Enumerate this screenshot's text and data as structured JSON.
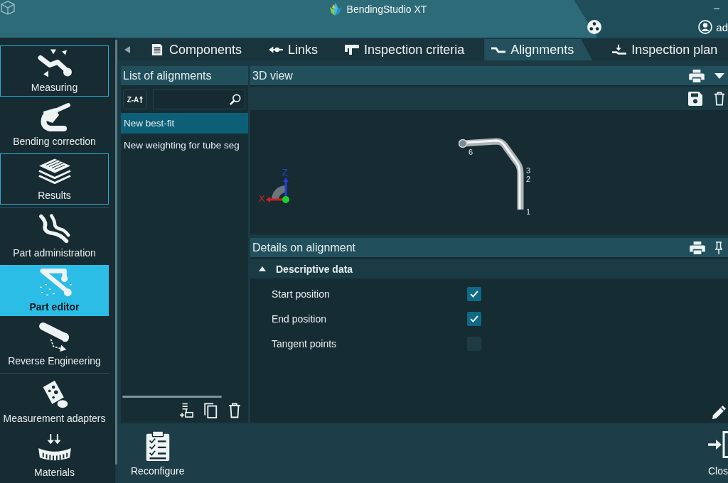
{
  "window": {
    "title": "BendingStudio XT",
    "minimize": "–",
    "user": "ad"
  },
  "sidebar": {
    "groups": [
      {
        "items": [
          {
            "label": "Measuring",
            "kind": "measuring",
            "framed": true,
            "selected": false
          },
          {
            "label": "Bending correction",
            "kind": "bending",
            "framed": false,
            "selected": false
          },
          {
            "label": "Results",
            "kind": "results",
            "framed": true,
            "selected": false
          }
        ]
      },
      {
        "items": [
          {
            "label": "Part administration",
            "kind": "parts",
            "framed": false,
            "selected": false
          },
          {
            "label": "Part editor",
            "kind": "editor",
            "framed": false,
            "selected": true
          },
          {
            "label": "Reverse Engineering",
            "kind": "reverse",
            "framed": false,
            "selected": false
          }
        ]
      },
      {
        "items": [
          {
            "label": "Measurement adapters",
            "kind": "adapters",
            "framed": false,
            "selected": false
          },
          {
            "label": "Materials",
            "kind": "materials",
            "framed": false,
            "selected": false
          }
        ]
      }
    ]
  },
  "tabs": [
    {
      "label": "Components",
      "kind": "components",
      "selected": false
    },
    {
      "label": "Links",
      "kind": "links",
      "selected": false
    },
    {
      "label": "Inspection criteria",
      "kind": "criteria",
      "selected": false
    },
    {
      "label": "Alignments",
      "kind": "alignments",
      "selected": true
    },
    {
      "label": "Inspection plan",
      "kind": "plan",
      "selected": false
    }
  ],
  "list_panel": {
    "title": "List of alignments",
    "sort_button": "Z-A",
    "items": [
      {
        "label": "New best-fit",
        "selected": true
      },
      {
        "label": "New weighting for tube seg",
        "selected": false
      }
    ]
  },
  "view_panel": {
    "title": "3D view",
    "point_labels": [
      "6",
      "3",
      "2",
      "1"
    ],
    "axes": {
      "x": "X",
      "z": "Z"
    }
  },
  "details_panel": {
    "title": "Details on alignment",
    "section": {
      "title": "Descriptive data",
      "expanded": true,
      "rows": [
        {
          "label": "Start position",
          "checked": true
        },
        {
          "label": "End position",
          "checked": true
        },
        {
          "label": "Tangent points",
          "checked": false
        }
      ]
    }
  },
  "bottom_bar": {
    "buttons": [
      {
        "label": "Reconfigure",
        "kind": "reconfigure"
      },
      {
        "label": "Clos",
        "kind": "close"
      }
    ]
  }
}
